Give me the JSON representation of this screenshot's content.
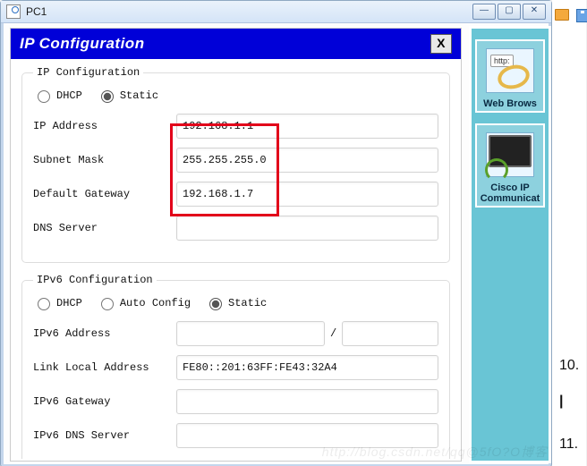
{
  "outer_window": {
    "title": "PC1"
  },
  "top_toolbar": {
    "open_icon": "folder-icon",
    "save_icon": "disk-icon"
  },
  "dialog": {
    "title": "IP Configuration",
    "close_label": "X"
  },
  "ipv4": {
    "legend": "IP Configuration",
    "option_dhcp": "DHCP",
    "option_static": "Static",
    "selected": "static",
    "fields": {
      "ip_label": "IP Address",
      "ip_value": "192.168.1.1",
      "mask_label": "Subnet Mask",
      "mask_value": "255.255.255.0",
      "gw_label": "Default Gateway",
      "gw_value": "192.168.1.7",
      "dns_label": "DNS Server",
      "dns_value": ""
    }
  },
  "ipv6": {
    "legend": "IPv6 Configuration",
    "option_dhcp": "DHCP",
    "option_auto": "Auto Config",
    "option_static": "Static",
    "selected": "static",
    "fields": {
      "addr_label": "IPv6 Address",
      "addr_value": "",
      "prefix_value": "",
      "lla_label": "Link Local Address",
      "lla_value": "FE80::201:63FF:FE43:32A4",
      "gw_label": "IPv6 Gateway",
      "gw_value": "",
      "dns_label": "IPv6 DNS Server",
      "dns_value": ""
    }
  },
  "side_apps": {
    "web_http_tag": "http:",
    "web_label": "Web Brows",
    "cisco_line1": "Cisco IP",
    "cisco_line2": "Communicat"
  },
  "notes": {
    "n10": "10.",
    "n11": "11."
  },
  "watermark": "http://blog.csdn.net/qq@5fO?O博客"
}
